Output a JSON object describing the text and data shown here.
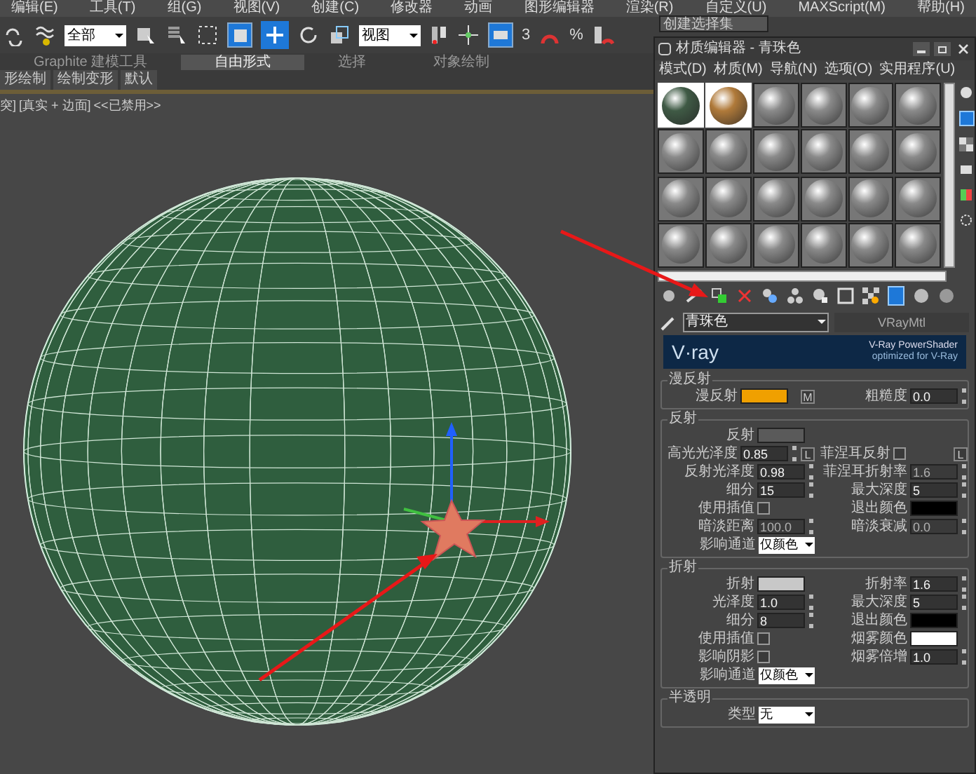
{
  "menu": [
    "编辑(E)",
    "工具(T)",
    "组(G)",
    "视图(V)",
    "创建(C)",
    "修改器",
    "动画",
    "图形编辑器",
    "渲染(R)",
    "自定义(U)",
    "MAXScript(M)",
    "帮助(H)"
  ],
  "toolbar": {
    "selection_filter": "全部",
    "coordinate_system": "视图",
    "snap_label": "3",
    "angle_snap_label": "%",
    "named_selection": "创建选择集"
  },
  "ribbon_tabs": [
    {
      "label": "Graphite 建模工具",
      "selected": false
    },
    {
      "label": "自由形式",
      "selected": true
    },
    {
      "label": "选择",
      "selected": false
    },
    {
      "label": "对象绘制",
      "selected": false
    }
  ],
  "ribbon_panels": [
    "形绘制",
    "绘制变形",
    "默认"
  ],
  "viewport": {
    "label_parts": [
      "突]",
      "[真实 + 边面]",
      "<<已禁用>>"
    ]
  },
  "material_editor": {
    "title": "材质编辑器 - 青珠色",
    "menu": [
      "模式(D)",
      "材质(M)",
      "导航(N)",
      "选项(O)",
      "实用程序(U)"
    ],
    "slots": [
      {
        "color": "#3f5a45",
        "assigned": true
      },
      {
        "color": "#b07a3a",
        "assigned": true
      },
      {
        "color": "#8a8a8a",
        "assigned": false
      },
      {
        "color": "#8a8a8a",
        "assigned": false
      },
      {
        "color": "#8a8a8a",
        "assigned": false
      },
      {
        "color": "#8a8a8a",
        "assigned": false
      },
      {
        "color": "#8a8a8a",
        "assigned": false
      },
      {
        "color": "#8a8a8a",
        "assigned": false
      },
      {
        "color": "#8a8a8a",
        "assigned": false
      },
      {
        "color": "#8a8a8a",
        "assigned": false
      },
      {
        "color": "#8a8a8a",
        "assigned": false
      },
      {
        "color": "#8a8a8a",
        "assigned": false
      },
      {
        "color": "#8a8a8a",
        "assigned": false
      },
      {
        "color": "#8a8a8a",
        "assigned": false
      },
      {
        "color": "#8a8a8a",
        "assigned": false
      },
      {
        "color": "#8a8a8a",
        "assigned": false
      },
      {
        "color": "#8a8a8a",
        "assigned": false
      },
      {
        "color": "#8a8a8a",
        "assigned": false
      },
      {
        "color": "#8a8a8a",
        "assigned": false
      },
      {
        "color": "#8a8a8a",
        "assigned": false
      },
      {
        "color": "#8a8a8a",
        "assigned": false
      },
      {
        "color": "#8a8a8a",
        "assigned": false
      },
      {
        "color": "#8a8a8a",
        "assigned": false
      },
      {
        "color": "#8a8a8a",
        "assigned": false
      }
    ],
    "material_name": "青珠色",
    "material_type": "VRayMtl",
    "banner": {
      "logo": "V·ray",
      "title": "V-Ray PowerShader",
      "subtitle": "optimized for V-Ray"
    },
    "sections": [
      {
        "title": "漫反射",
        "rows": [
          {
            "left": {
              "label": "漫反射",
              "kind": "swatch",
              "color": "#f0a000",
              "map": "M"
            },
            "right": {
              "label": "粗糙度",
              "kind": "spinner",
              "value": "0.0",
              "disabled": false
            }
          }
        ]
      },
      {
        "title": "反射",
        "rows": [
          {
            "left": {
              "label": "反射",
              "kind": "swatch",
              "color": "#5a5a5a"
            },
            "right": null
          },
          {
            "left": {
              "label": "高光光泽度",
              "kind": "spinner",
              "value": "0.85",
              "disabled": false,
              "lock": "L"
            },
            "right": {
              "label": "菲涅耳反射",
              "kind": "check",
              "checked": false,
              "lock": "L"
            }
          },
          {
            "left": {
              "label": "反射光泽度",
              "kind": "spinner",
              "value": "0.98",
              "disabled": false
            },
            "right": {
              "label": "菲涅耳折射率",
              "kind": "spinner",
              "value": "1.6",
              "disabled": true
            }
          },
          {
            "left": {
              "label": "细分",
              "kind": "spinner",
              "value": "15",
              "disabled": false
            },
            "right": {
              "label": "最大深度",
              "kind": "spinner",
              "value": "5",
              "disabled": false
            }
          },
          {
            "left": {
              "label": "使用插值",
              "kind": "check",
              "checked": false
            },
            "right": {
              "label": "退出颜色",
              "kind": "swatch",
              "color": "#000000"
            }
          },
          {
            "left": {
              "label": "暗淡距离",
              "kind": "spinner",
              "value": "100.0",
              "disabled": true
            },
            "right": {
              "label": "暗淡衰减",
              "kind": "spinner",
              "value": "0.0",
              "disabled": true
            }
          },
          {
            "left": {
              "label": "影响通道",
              "kind": "dropdown",
              "value": "仅颜色"
            },
            "right": null
          }
        ]
      },
      {
        "title": "折射",
        "rows": [
          {
            "left": {
              "label": "折射",
              "kind": "swatch",
              "color": "#c8c8c8"
            },
            "right": {
              "label": "折射率",
              "kind": "spinner",
              "value": "1.6",
              "disabled": false
            }
          },
          {
            "left": {
              "label": "光泽度",
              "kind": "spinner",
              "value": "1.0",
              "disabled": false
            },
            "right": {
              "label": "最大深度",
              "kind": "spinner",
              "value": "5",
              "disabled": false
            }
          },
          {
            "left": {
              "label": "细分",
              "kind": "spinner",
              "value": "8",
              "disabled": false
            },
            "right": {
              "label": "退出颜色",
              "kind": "swatch",
              "color": "#000000"
            }
          },
          {
            "left": {
              "label": "使用插值",
              "kind": "check",
              "checked": false
            },
            "right": {
              "label": "烟雾颜色",
              "kind": "swatch",
              "color": "#ffffff"
            }
          },
          {
            "left": {
              "label": "影响阴影",
              "kind": "check",
              "checked": false
            },
            "right": {
              "label": "烟雾倍增",
              "kind": "spinner",
              "value": "1.0",
              "disabled": false
            }
          },
          {
            "left": {
              "label": "影响通道",
              "kind": "dropdown",
              "value": "仅颜色"
            },
            "right": null
          }
        ]
      },
      {
        "title": "半透明",
        "rows": [
          {
            "left": {
              "label": "类型",
              "kind": "dropdown",
              "value": "无"
            },
            "right": null
          }
        ]
      }
    ]
  }
}
